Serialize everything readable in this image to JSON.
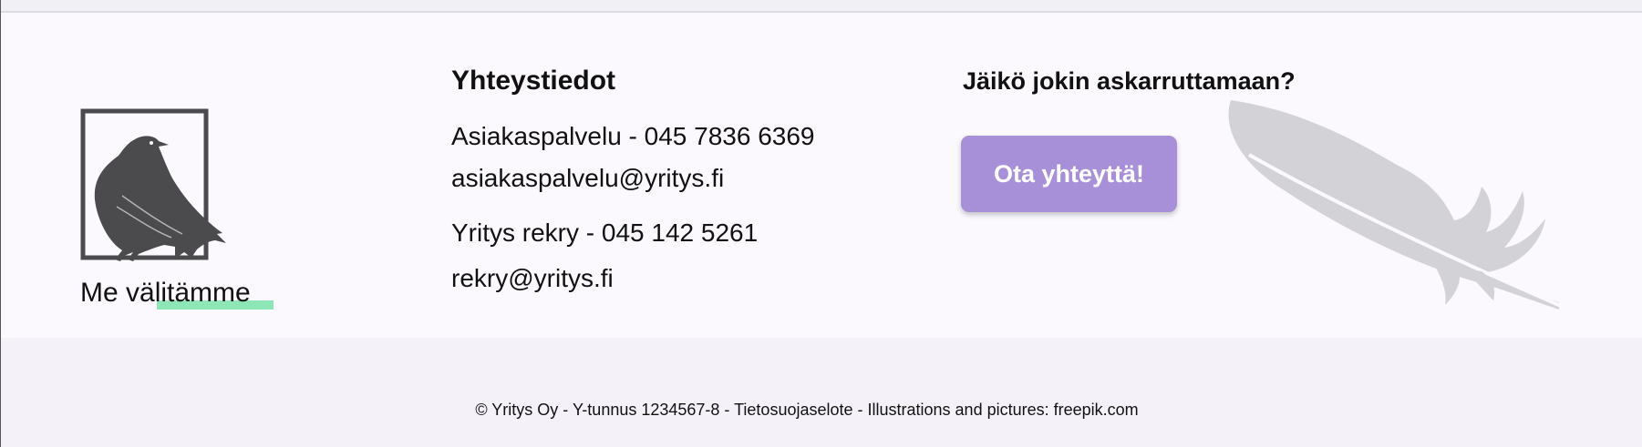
{
  "brand": {
    "tagline": "Me välitämme",
    "logo_icon": "raven-icon",
    "accent_underline": "#8ee6b6"
  },
  "contact": {
    "heading": "Yhteystiedot",
    "lines": [
      "Asiakaspalvelu - 045 7836 6369",
      "asiakaspalvelu@yritys.fi",
      "Yritys rekry - 045 142 5261",
      "rekry@yritys.fi"
    ]
  },
  "cta": {
    "heading": "Jäikö jokin askarruttamaan?",
    "button_label": "Ota yhteyttä!",
    "button_color": "#a890d8",
    "decoration_icon": "feather-icon"
  },
  "footer": {
    "copyright": "© Yritys Oy - Y-tunnus 1234567-8 - Tietosuojaselote - Illustrations and pictures: freepik.com"
  }
}
